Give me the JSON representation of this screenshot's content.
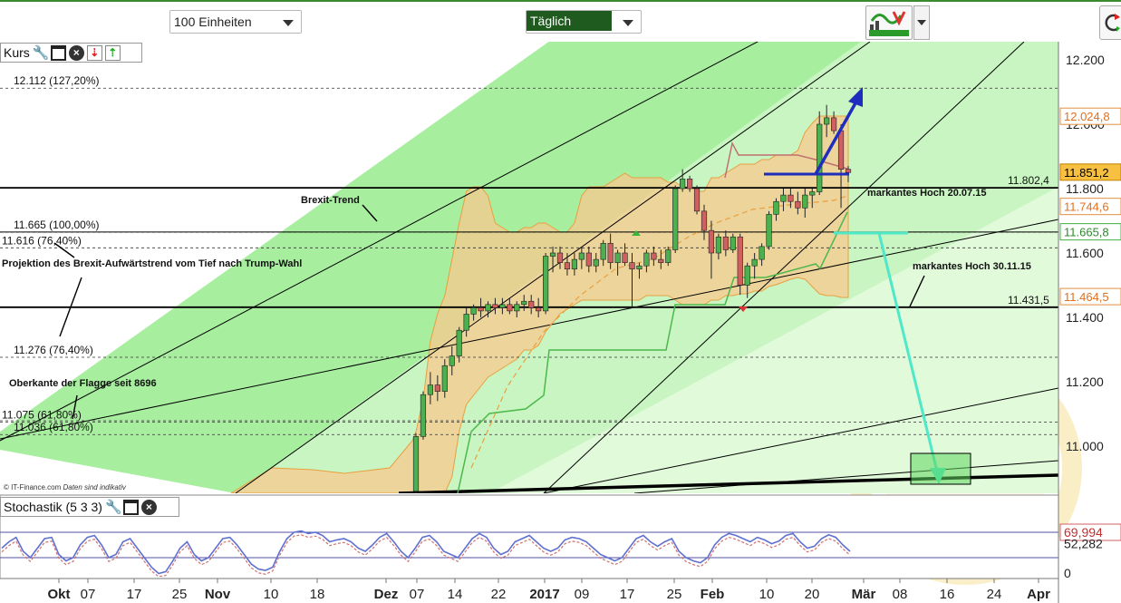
{
  "toolbar": {
    "units_value": "100 Einheiten",
    "interval_value": "Täglich",
    "chart_tools_icon": "chart-tools-icon",
    "refresh_icon": "refresh-icon"
  },
  "price_panel": {
    "title": "Kurs",
    "credit": "© IT-Finance.com",
    "disclaimer": "Daten sind indikativ"
  },
  "stoch_panel": {
    "title": "Stochastik (5 3 3)"
  },
  "colors": {
    "frame_green": "#3c8a2e",
    "channel_fill": "#a8eea0",
    "bollinger_fill": "#f7c88e",
    "candle_up": "#4caf50",
    "candle_down": "#d06060",
    "arrow_blue": "#1f2dbf",
    "arrow_teal": "#4fe8c8"
  },
  "chart_data": {
    "type": "candlestick",
    "y_axis": {
      "min": 10.7,
      "max": 12.25,
      "ticks": [
        "12.200",
        "12.000",
        "11.800",
        "11.600",
        "11.400",
        "11.200",
        "11.000"
      ]
    },
    "x_axis": {
      "ticks": [
        "Okt",
        "07",
        "17",
        "25",
        "Nov",
        "10",
        "18",
        "Dez",
        "07",
        "14",
        "22",
        "2017",
        "09",
        "17",
        "25",
        "Feb",
        "10",
        "20",
        "Mär",
        "08",
        "16",
        "24",
        "Apr"
      ]
    },
    "price_badges": [
      {
        "label": "12.024,8",
        "value": 12.0248,
        "style": "orange"
      },
      {
        "label": "11.851,2",
        "value": 11.8512,
        "style": "highlight"
      },
      {
        "label": "11.744,6",
        "value": 11.7446,
        "style": "orange"
      },
      {
        "label": "11.665,8",
        "value": 11.6658,
        "style": "green"
      },
      {
        "label": "11.464,5",
        "value": 11.4645,
        "style": "orange"
      }
    ],
    "levels": [
      {
        "label": "12.112 (127,20%)",
        "value": 12.112
      },
      {
        "label": "11.665 (100,00%)",
        "value": 11.665
      },
      {
        "label": "11.616 (76,40%)",
        "value": 11.616
      },
      {
        "label": "11.276 (76,40%)",
        "value": 11.276
      },
      {
        "label": "11.075 (61,80%)",
        "value": 11.075
      },
      {
        "label": "11.036 (61,80%)",
        "value": 11.036
      }
    ],
    "horizontal_lines": [
      {
        "label": "11.802,4",
        "value": 11.8024
      },
      {
        "label": "11.431,5",
        "value": 11.4315
      }
    ],
    "annotations": [
      "Brexit-Trend",
      "Projektion des  Brexit-Aufwärtstrend vom Tief nach Trump-Wahl",
      "Oberkante der Flagge seit 8696",
      "markantes Hoch 20.07.15",
      "markantes Hoch 30.11.15"
    ],
    "candles": [
      {
        "o": 10.86,
        "h": 11.04,
        "l": 10.84,
        "c": 11.03
      },
      {
        "o": 11.03,
        "h": 11.17,
        "l": 11.02,
        "c": 11.16
      },
      {
        "o": 11.16,
        "h": 11.23,
        "l": 11.13,
        "c": 11.19
      },
      {
        "o": 11.19,
        "h": 11.22,
        "l": 11.14,
        "c": 11.17
      },
      {
        "o": 11.17,
        "h": 11.27,
        "l": 11.15,
        "c": 11.25
      },
      {
        "o": 11.25,
        "h": 11.31,
        "l": 11.22,
        "c": 11.28
      },
      {
        "o": 11.28,
        "h": 11.37,
        "l": 11.26,
        "c": 11.36
      },
      {
        "o": 11.36,
        "h": 11.43,
        "l": 11.34,
        "c": 11.41
      },
      {
        "o": 11.41,
        "h": 11.44,
        "l": 11.39,
        "c": 11.43
      },
      {
        "o": 11.43,
        "h": 11.46,
        "l": 11.4,
        "c": 11.42
      },
      {
        "o": 11.42,
        "h": 11.45,
        "l": 11.4,
        "c": 11.44
      },
      {
        "o": 11.44,
        "h": 11.46,
        "l": 11.41,
        "c": 11.43
      },
      {
        "o": 11.43,
        "h": 11.46,
        "l": 11.41,
        "c": 11.44
      },
      {
        "o": 11.44,
        "h": 11.46,
        "l": 11.41,
        "c": 11.42
      },
      {
        "o": 11.42,
        "h": 11.45,
        "l": 11.4,
        "c": 11.44
      },
      {
        "o": 11.44,
        "h": 11.47,
        "l": 11.42,
        "c": 11.45
      },
      {
        "o": 11.45,
        "h": 11.47,
        "l": 11.41,
        "c": 11.43
      },
      {
        "o": 11.43,
        "h": 11.46,
        "l": 11.4,
        "c": 11.42
      },
      {
        "o": 11.42,
        "h": 11.6,
        "l": 11.41,
        "c": 11.59
      },
      {
        "o": 11.59,
        "h": 11.62,
        "l": 11.54,
        "c": 11.6
      },
      {
        "o": 11.6,
        "h": 11.62,
        "l": 11.55,
        "c": 11.57
      },
      {
        "o": 11.57,
        "h": 11.6,
        "l": 11.53,
        "c": 11.55
      },
      {
        "o": 11.55,
        "h": 11.6,
        "l": 11.53,
        "c": 11.58
      },
      {
        "o": 11.58,
        "h": 11.62,
        "l": 11.55,
        "c": 11.6
      },
      {
        "o": 11.6,
        "h": 11.62,
        "l": 11.54,
        "c": 11.56
      },
      {
        "o": 11.56,
        "h": 11.6,
        "l": 11.54,
        "c": 11.58
      },
      {
        "o": 11.58,
        "h": 11.64,
        "l": 11.56,
        "c": 11.63
      },
      {
        "o": 11.63,
        "h": 11.66,
        "l": 11.55,
        "c": 11.57
      },
      {
        "o": 11.57,
        "h": 11.61,
        "l": 11.53,
        "c": 11.6
      },
      {
        "o": 11.6,
        "h": 11.63,
        "l": 11.56,
        "c": 11.57
      },
      {
        "o": 11.57,
        "h": 11.6,
        "l": 11.43,
        "c": 11.55
      },
      {
        "o": 11.55,
        "h": 11.57,
        "l": 11.52,
        "c": 11.56
      },
      {
        "o": 11.56,
        "h": 11.61,
        "l": 11.54,
        "c": 11.6
      },
      {
        "o": 11.6,
        "h": 11.62,
        "l": 11.56,
        "c": 11.58
      },
      {
        "o": 11.58,
        "h": 11.61,
        "l": 11.55,
        "c": 11.57
      },
      {
        "o": 11.57,
        "h": 11.62,
        "l": 11.56,
        "c": 11.61
      },
      {
        "o": 11.61,
        "h": 11.81,
        "l": 11.6,
        "c": 11.8
      },
      {
        "o": 11.8,
        "h": 11.86,
        "l": 11.79,
        "c": 11.83
      },
      {
        "o": 11.83,
        "h": 11.84,
        "l": 11.79,
        "c": 11.8
      },
      {
        "o": 11.8,
        "h": 11.81,
        "l": 11.72,
        "c": 11.73
      },
      {
        "o": 11.73,
        "h": 11.75,
        "l": 11.64,
        "c": 11.67
      },
      {
        "o": 11.67,
        "h": 11.7,
        "l": 11.52,
        "c": 11.6
      },
      {
        "o": 11.6,
        "h": 11.66,
        "l": 11.58,
        "c": 11.65
      },
      {
        "o": 11.65,
        "h": 11.67,
        "l": 11.59,
        "c": 11.61
      },
      {
        "o": 11.61,
        "h": 11.66,
        "l": 11.6,
        "c": 11.65
      },
      {
        "o": 11.65,
        "h": 11.66,
        "l": 11.47,
        "c": 11.5
      },
      {
        "o": 11.5,
        "h": 11.57,
        "l": 11.46,
        "c": 11.56
      },
      {
        "o": 11.56,
        "h": 11.6,
        "l": 11.52,
        "c": 11.58
      },
      {
        "o": 11.58,
        "h": 11.63,
        "l": 11.56,
        "c": 11.62
      },
      {
        "o": 11.62,
        "h": 11.73,
        "l": 11.61,
        "c": 11.72
      },
      {
        "o": 11.72,
        "h": 11.77,
        "l": 11.7,
        "c": 11.76
      },
      {
        "o": 11.76,
        "h": 11.8,
        "l": 11.73,
        "c": 11.78
      },
      {
        "o": 11.78,
        "h": 11.8,
        "l": 11.74,
        "c": 11.76
      },
      {
        "o": 11.76,
        "h": 11.79,
        "l": 11.72,
        "c": 11.74
      },
      {
        "o": 11.74,
        "h": 11.8,
        "l": 11.71,
        "c": 11.78
      },
      {
        "o": 11.78,
        "h": 11.8,
        "l": 11.74,
        "c": 11.79
      },
      {
        "o": 11.79,
        "h": 12.04,
        "l": 11.78,
        "c": 12.0
      },
      {
        "o": 12.0,
        "h": 12.06,
        "l": 11.96,
        "c": 12.02
      },
      {
        "o": 12.02,
        "h": 12.04,
        "l": 11.97,
        "c": 11.98
      },
      {
        "o": 11.98,
        "h": 12.0,
        "l": 11.74,
        "c": 11.86
      },
      {
        "o": 11.86,
        "h": 11.87,
        "l": 11.82,
        "c": 11.85
      }
    ],
    "stochastic": {
      "title": "Stochastik (5 3 3)",
      "y_labels": [
        "69,994",
        "52,282",
        "0"
      ],
      "y_range": [
        0,
        100
      ]
    }
  }
}
